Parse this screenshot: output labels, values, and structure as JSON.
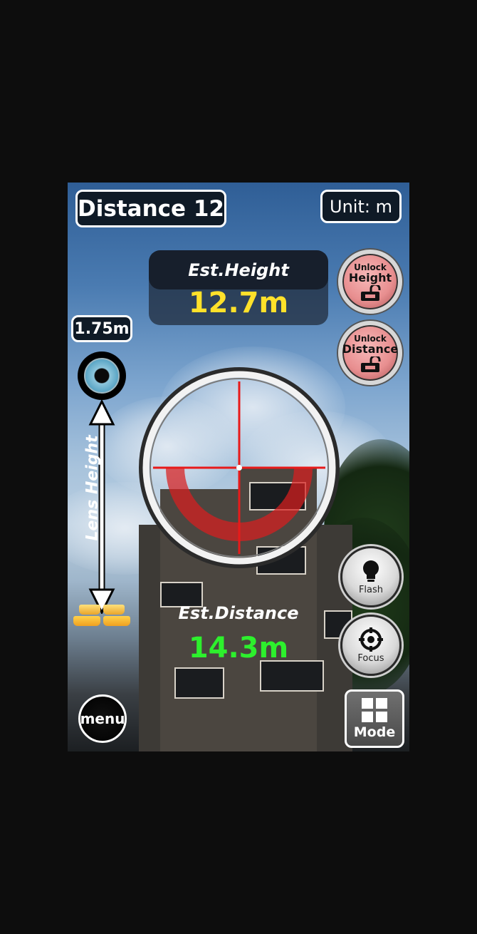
{
  "header": {
    "title": "Distance 12",
    "unit_label": "Unit: m"
  },
  "height_panel": {
    "caption": "Est.Height",
    "value": "12.7m"
  },
  "lens": {
    "height_value": "1.75m",
    "label": "Lens Height"
  },
  "buttons": {
    "unlock_height_line1": "Unlock",
    "unlock_height_line2": "Height",
    "unlock_distance_line1": "Unlock",
    "unlock_distance_line2": "Distance",
    "flash_label": "Flash",
    "focus_label": "Focus",
    "menu_label": "menu",
    "mode_label": "Mode"
  },
  "distance_panel": {
    "caption": "Est.Distance",
    "value": "14.3m"
  },
  "colors": {
    "height_value": "#ffe12a",
    "distance_value": "#2df02d",
    "crosshair": "#e81a1a",
    "lock_button": "#e88f90"
  },
  "icons": {
    "eye": "eye-icon",
    "feet": "feet-icon",
    "lock": "unlocked-padlock-icon",
    "flash": "lightbulb-icon",
    "focus": "target-icon",
    "mode": "grid-icon"
  }
}
